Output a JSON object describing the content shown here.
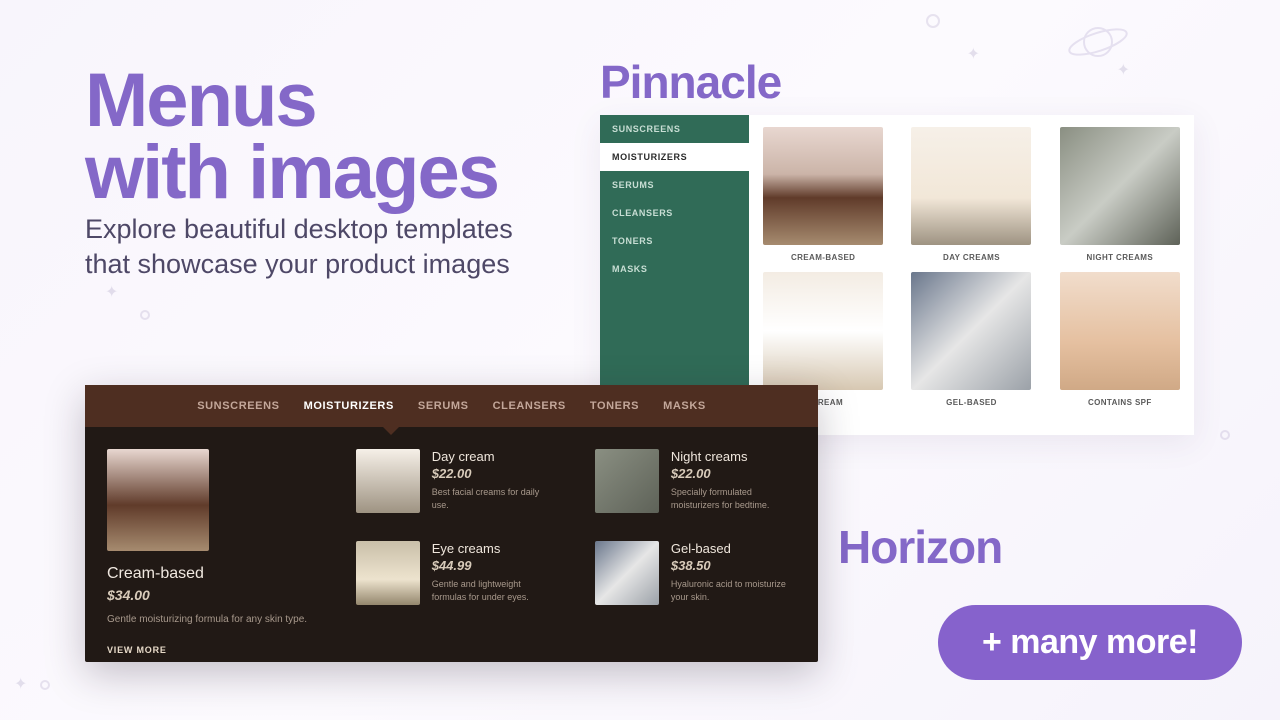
{
  "headline": {
    "line1": "Menus",
    "line2": "with images"
  },
  "subhead": {
    "line1": "Explore beautiful desktop templates",
    "line2": "that showcase your product images"
  },
  "templates": {
    "pinnacle_label": "Pinnacle",
    "horizon_label": "Horizon"
  },
  "pinnacle": {
    "sidebar": [
      "SUNSCREENS",
      "MOISTURIZERS",
      "SERUMS",
      "CLEANSERS",
      "TONERS",
      "MASKS"
    ],
    "active_index": 1,
    "grid": [
      {
        "label": "CREAM-BASED"
      },
      {
        "label": "DAY CREAMS"
      },
      {
        "label": "NIGHT CREAMS"
      },
      {
        "label": "E CREAM"
      },
      {
        "label": "GEL-BASED"
      },
      {
        "label": "CONTAINS SPF"
      }
    ]
  },
  "horizon": {
    "tabs": [
      "SUNSCREENS",
      "MOISTURIZERS",
      "SERUMS",
      "CLEANSERS",
      "TONERS",
      "MASKS"
    ],
    "active_index": 1,
    "featured": {
      "title": "Cream-based",
      "price": "$34.00",
      "desc": "Gentle moisturizing formula for any skin type.",
      "view_more": "VIEW MORE"
    },
    "col1": [
      {
        "title": "Day cream",
        "price": "$22.00",
        "desc": "Best facial creams for daily use."
      },
      {
        "title": "Eye creams",
        "price": "$44.99",
        "desc": "Gentle and lightweight formulas for under eyes."
      }
    ],
    "col2": [
      {
        "title": "Night creams",
        "price": "$22.00",
        "desc": "Specially formulated moisturizers for bedtime."
      },
      {
        "title": "Gel-based",
        "price": "$38.50",
        "desc": "Hyaluronic acid to moisturize your skin."
      }
    ]
  },
  "cta": {
    "label": "+ many more!"
  }
}
